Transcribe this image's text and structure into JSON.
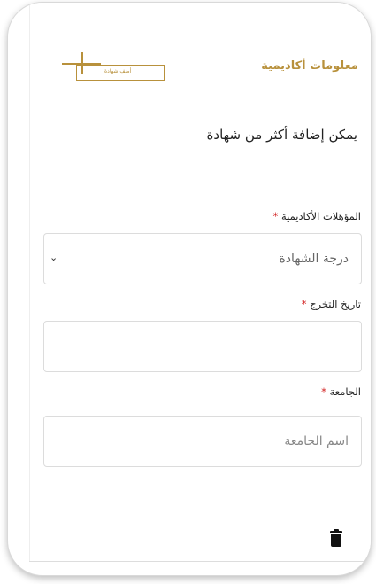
{
  "section": {
    "title": "معلومات أكاديمية",
    "add_certificate_label": "أضف شهادة"
  },
  "hint": "يمكن إضافة أكثر من شهادة",
  "fields": {
    "qualification": {
      "label": "المؤهلات الأكاديمية",
      "value": "درجة الشهادة"
    },
    "graduation_date": {
      "label": "تاريخ التخرج",
      "value": ""
    },
    "university": {
      "label": "الجامعة",
      "placeholder": "اسم الجامعة"
    }
  },
  "required_mark": "*",
  "colors": {
    "accent": "#b8913c",
    "required": "#d21e1e"
  },
  "icons": {
    "add": "plus-icon",
    "dropdown": "chevron-down-icon",
    "delete": "trash-icon"
  }
}
